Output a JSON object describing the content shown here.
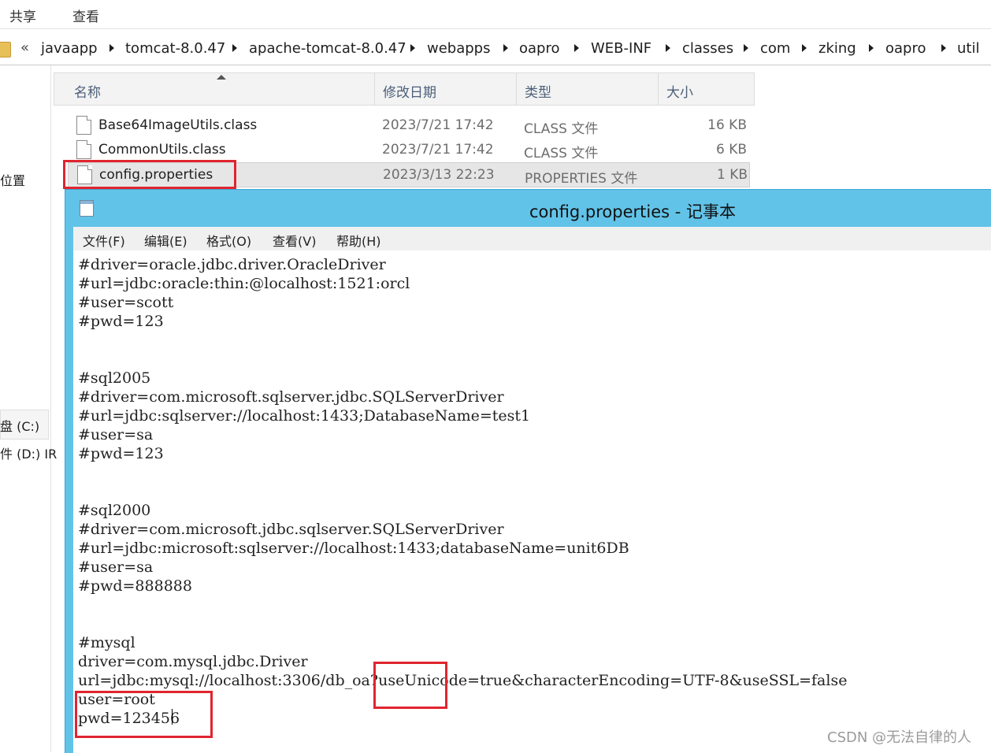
{
  "ribbon": {
    "tabs": [
      "共享",
      "查看"
    ]
  },
  "address": {
    "back_glyph": "«",
    "path": [
      "javaapp",
      "tomcat-8.0.47",
      "apache-tomcat-8.0.47",
      "webapps",
      "oapro",
      "WEB-INF",
      "classes",
      "com",
      "zking",
      "oapro",
      "util"
    ]
  },
  "navpane": {
    "items": [
      "位置",
      "盘 (C:)",
      "件 (D:) IR"
    ]
  },
  "filelist": {
    "columns": {
      "name": "名称",
      "date": "修改日期",
      "type": "类型",
      "size": "大小"
    },
    "rows": [
      {
        "name": "Base64ImageUtils.class",
        "date": "2023/7/21 17:42",
        "type": "CLASS 文件",
        "size": "16 KB"
      },
      {
        "name": "CommonUtils.class",
        "date": "2023/7/21 17:42",
        "type": "CLASS 文件",
        "size": "6 KB"
      },
      {
        "name": "config.properties",
        "date": "2023/3/13 22:23",
        "type": "PROPERTIES 文件",
        "size": "1 KB"
      }
    ]
  },
  "notepad": {
    "title": "config.properties - 记事本",
    "menu": [
      "文件(F)",
      "编辑(E)",
      "格式(O)",
      "查看(V)",
      "帮助(H)"
    ],
    "content": "#driver=oracle.jdbc.driver.OracleDriver\n#url=jdbc:oracle:thin:@localhost:1521:orcl\n#user=scott\n#pwd=123\n\n\n#sql2005\n#driver=com.microsoft.sqlserver.jdbc.SQLServerDriver\n#url=jdbc:sqlserver://localhost:1433;DatabaseName=test1\n#user=sa\n#pwd=123\n\n\n#sql2000\n#driver=com.microsoft.jdbc.sqlserver.SQLServerDriver\n#url=jdbc:microsoft:sqlserver://localhost:1433;databaseName=unit6DB\n#user=sa\n#pwd=888888\n\n\n#mysql\ndriver=com.mysql.jdbc.Driver\nurl=jdbc:mysql://localhost:3306/db_oa?useUnicode=true&characterEncoding=UTF-8&useSSL=false\nuser=root\npwd=123456"
  },
  "watermark": "CSDN @无法自律的人",
  "colors": {
    "highlight": "#e0252f",
    "notepad_frame": "#62c3e8"
  }
}
